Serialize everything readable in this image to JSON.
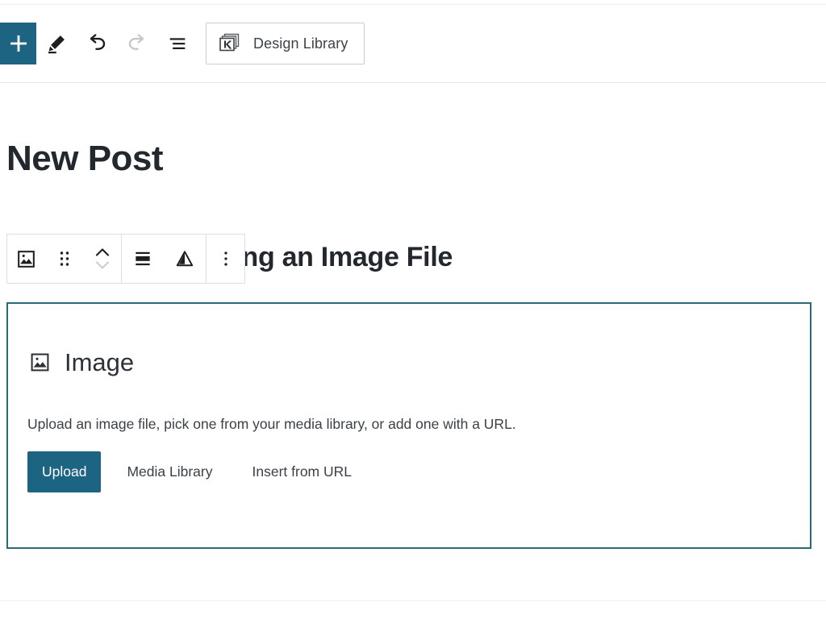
{
  "app": {
    "name": "WordPress Block Editor",
    "accent_color": "#1d6482",
    "placeholder_border_color": "#2a6a74",
    "text_color": "#1e1e1e"
  },
  "header": {
    "add_block": {
      "label": "+",
      "icon": "plus-icon",
      "title": "Toggle block inserter"
    },
    "tools": [
      {
        "icon": "pencil-icon",
        "label": "Edit",
        "state": "enabled"
      },
      {
        "icon": "undo-arrow-icon",
        "label": "Undo",
        "state": "enabled"
      },
      {
        "icon": "redo-arrow-icon",
        "label": "Redo",
        "state": "disabled"
      },
      {
        "icon": "list-view-icon",
        "label": "Details",
        "state": "enabled"
      }
    ],
    "design_library": {
      "label": "Design Library",
      "icon": "design-library-icon"
    }
  },
  "post": {
    "title": "New Post",
    "heading": "Block and Uploading an Image File"
  },
  "block_toolbar": {
    "buttons": [
      {
        "icon": "image-block-icon",
        "label": "Image",
        "group": 1
      },
      {
        "icon": "drag-handle-icon",
        "label": "Drag",
        "group": 1
      },
      {
        "icon": "move-up-down-icon",
        "label": "Move up or down",
        "group": 1
      },
      {
        "icon": "align-icon",
        "label": "Align",
        "group": 2
      },
      {
        "icon": "duotone-filter-icon",
        "label": "Apply duotone filter",
        "group": 2
      },
      {
        "icon": "more-options-icon",
        "label": "Options",
        "group": 3
      }
    ]
  },
  "image_block": {
    "icon": "image-icon",
    "title": "Image",
    "description": "Upload an image file, pick one from your media library, or add one with a URL.",
    "actions": {
      "upload": "Upload",
      "media_library": "Media Library",
      "insert_from_url": "Insert from URL"
    }
  }
}
